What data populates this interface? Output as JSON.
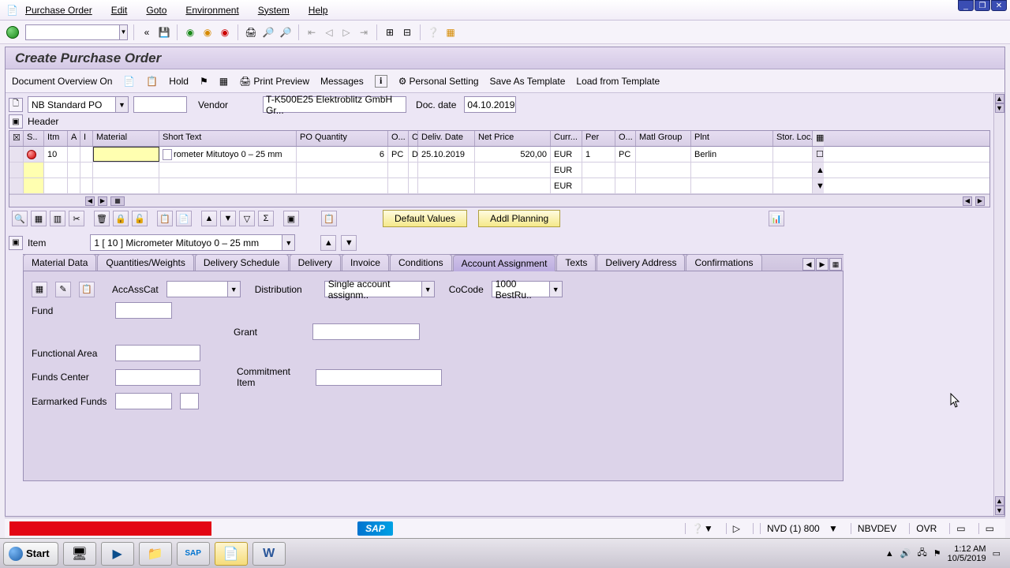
{
  "menu": {
    "po": "Purchase Order",
    "edit": "Edit",
    "goto": "Goto",
    "env": "Environment",
    "sys": "System",
    "help": "Help"
  },
  "page_title": "Create Purchase Order",
  "apptb": {
    "doc_over": "Document Overview On",
    "hold": "Hold",
    "print_prev": "Print Preview",
    "messages": "Messages",
    "personal": "Personal Setting",
    "save_tmpl": "Save As Template",
    "load_tmpl": "Load from Template"
  },
  "hdr": {
    "doc_type": "NB Standard PO",
    "vendor_lbl": "Vendor",
    "vendor_val": "T-K500E25 Elektroblitz GmbH Gr...",
    "docdate_lbl": "Doc. date",
    "docdate_val": "04.10.2019",
    "header_lbl": "Header"
  },
  "grid": {
    "cols": [
      "S..",
      "Itm",
      "A",
      "I",
      "Material",
      "Short Text",
      "PO Quantity",
      "O...",
      "C",
      "Deliv. Date",
      "Net Price",
      "Curr...",
      "Per",
      "O...",
      "Matl Group",
      "Plnt",
      "Stor. Loc."
    ],
    "rows": [
      {
        "s": "●",
        "itm": "10",
        "a": "",
        "i": "",
        "mat": "",
        "short": "rometer Mitutoyo 0 – 25 mm",
        "qty": "6",
        "ou": "PC",
        "c": "D",
        "deliv": "25.10.2019",
        "price": "520,00",
        "curr": "EUR",
        "per": "1",
        "ou2": "PC",
        "matg": "",
        "plnt": "Berlin"
      },
      {
        "curr": "EUR"
      },
      {
        "curr": "EUR"
      }
    ]
  },
  "btns": {
    "default_vals": "Default Values",
    "addl_plan": "Addl Planning"
  },
  "item": {
    "lbl": "Item",
    "sel": "1 [ 10 ] Micrometer Mitutoyo 0 – 25 mm"
  },
  "tabs": [
    "Material Data",
    "Quantities/Weights",
    "Delivery Schedule",
    "Delivery",
    "Invoice",
    "Conditions",
    "Account Assignment",
    "Texts",
    "Delivery Address",
    "Confirmations"
  ],
  "active_tab": 6,
  "form": {
    "accasscat": "AccAssCat",
    "distribution": "Distribution",
    "dist_val": "Single account assignm..",
    "cocode": "CoCode",
    "cocode_val": "1000 BestRu..",
    "fund": "Fund",
    "grant": "Grant",
    "funcarea": "Functional Area",
    "fundscenter": "Funds Center",
    "commitment": "Commitment Item",
    "earmarked": "Earmarked Funds"
  },
  "status": {
    "conn": "NVD (1) 800",
    "srv": "NBVDEV",
    "ovr": "OVR"
  },
  "taskbar": {
    "start": "Start",
    "time": "1:12 AM",
    "date": "10/5/2019"
  }
}
